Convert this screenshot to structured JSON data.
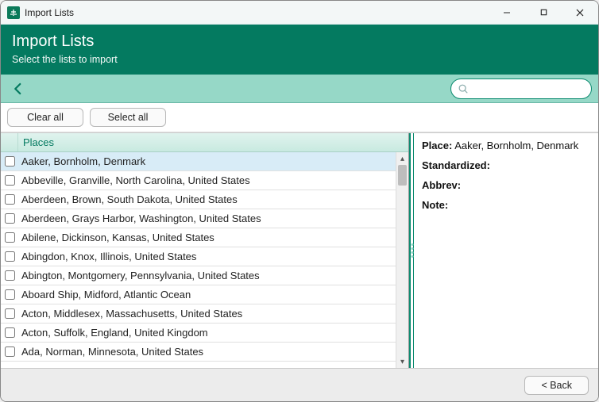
{
  "window": {
    "title": "Import Lists"
  },
  "header": {
    "title": "Import Lists",
    "subtitle": "Select the lists to import"
  },
  "search": {
    "value": "",
    "placeholder": ""
  },
  "buttons": {
    "clear_all": "Clear all",
    "select_all": "Select all",
    "back": "< Back"
  },
  "list": {
    "header": "Places",
    "items": [
      {
        "text": "Aaker, Bornholm, Denmark",
        "selected": true
      },
      {
        "text": "Abbeville, Granville, North Carolina, United States",
        "selected": false
      },
      {
        "text": "Aberdeen, Brown, South Dakota, United States",
        "selected": false
      },
      {
        "text": "Aberdeen, Grays Harbor, Washington, United States",
        "selected": false
      },
      {
        "text": "Abilene, Dickinson, Kansas, United States",
        "selected": false
      },
      {
        "text": "Abingdon, Knox, Illinois, United States",
        "selected": false
      },
      {
        "text": "Abington, Montgomery, Pennsylvania, United States",
        "selected": false
      },
      {
        "text": "Aboard Ship, Midford, Atlantic Ocean",
        "selected": false
      },
      {
        "text": "Acton, Middlesex, Massachusetts, United States",
        "selected": false
      },
      {
        "text": "Acton, Suffolk, England, United Kingdom",
        "selected": false
      },
      {
        "text": "Ada, Norman, Minnesota, United States",
        "selected": false
      }
    ]
  },
  "detail": {
    "place_label": "Place:",
    "place_value": "Aaker, Bornholm, Denmark",
    "standardized_label": "Standardized:",
    "standardized_value": "",
    "abbrev_label": "Abbrev:",
    "abbrev_value": "",
    "note_label": "Note:",
    "note_value": ""
  }
}
